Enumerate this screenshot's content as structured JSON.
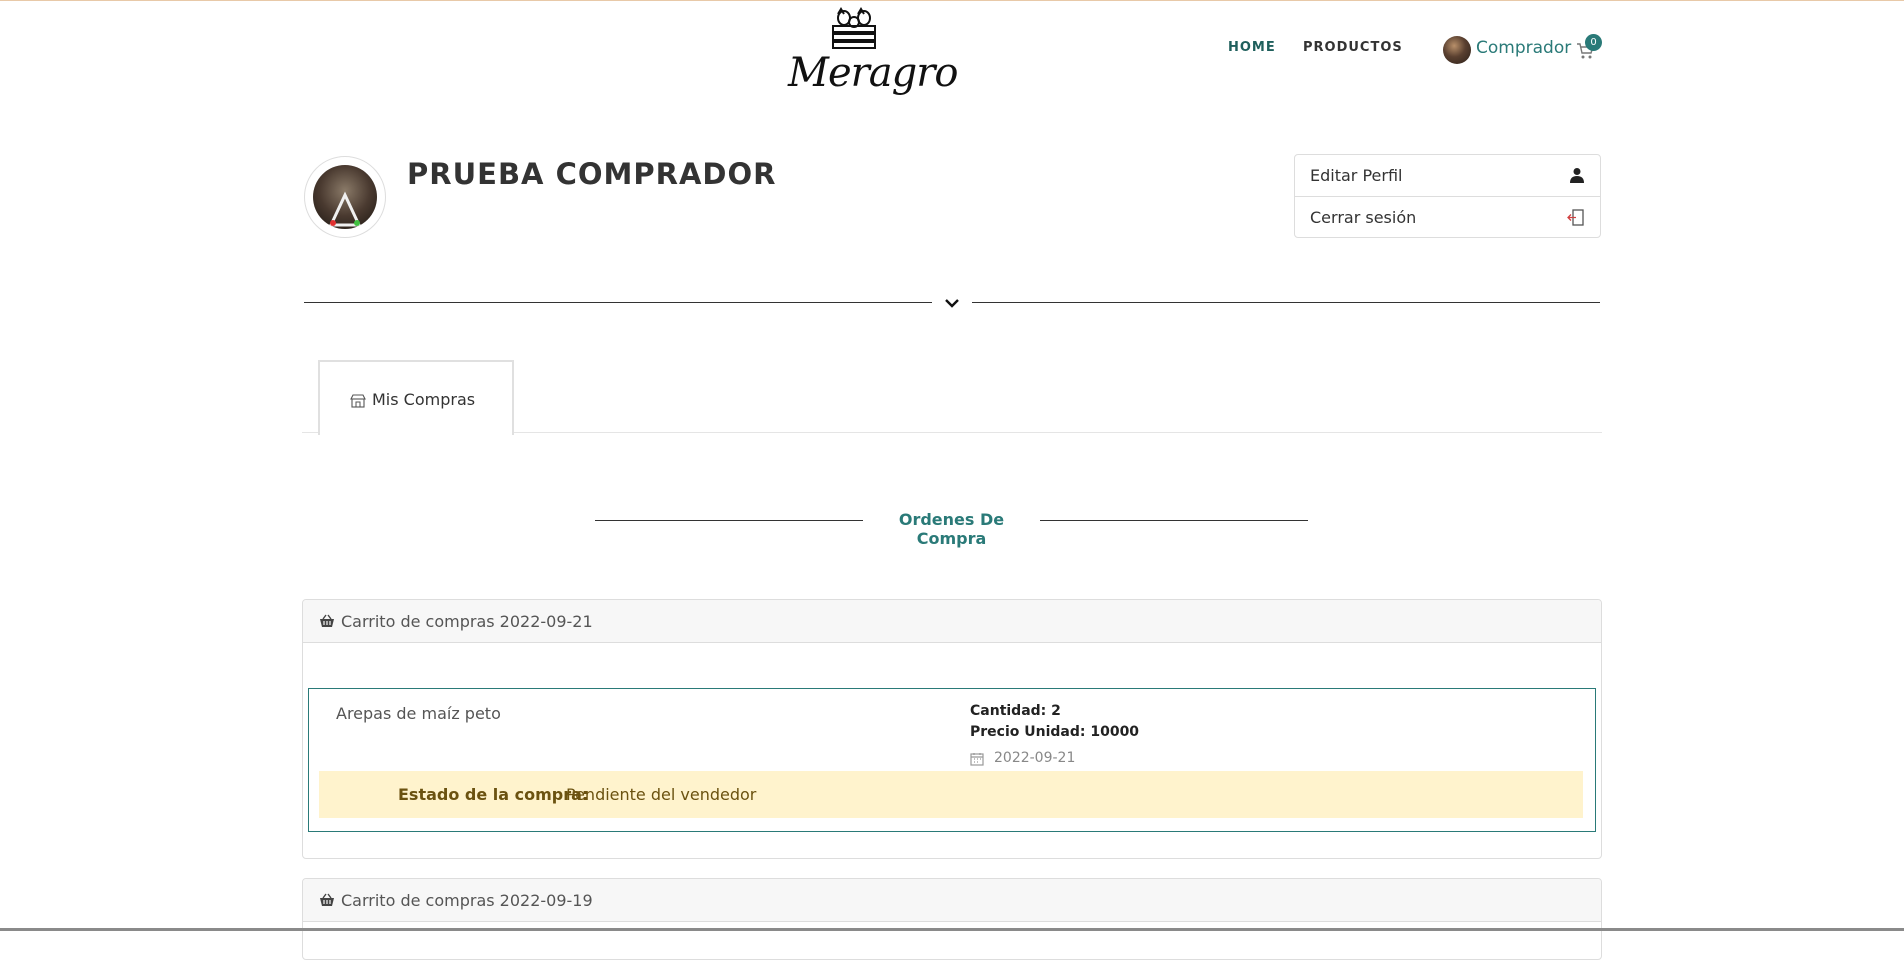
{
  "header": {
    "logo_text": "Meragro",
    "nav": {
      "home": "HOME",
      "products": "PRODUCTOS"
    },
    "user_name": "Comprador",
    "cart_count": "0"
  },
  "profile": {
    "name": "PRUEBA COMPRADOR",
    "menu": {
      "edit": "Editar Perfil",
      "logout": "Cerrar sesión"
    }
  },
  "tabs": [
    {
      "label": "Mis Compras",
      "active": true
    }
  ],
  "section_title": "Ordenes De Compra",
  "orders": [
    {
      "title": "Carrito de compras 2022-09-21",
      "item": {
        "name": "Arepas de maíz peto",
        "quantity_label": "Cantidad: 2",
        "price_label": "Precio Unidad: 10000",
        "date": "2022-09-21",
        "status_key": "Estado de la compra:",
        "status_value": "Pendiente del vendedor"
      }
    },
    {
      "title": "Carrito de compras 2022-09-19"
    }
  ],
  "colors": {
    "accent": "#2a7a78",
    "status_bg": "#fff3cd",
    "status_text": "#6b5210"
  }
}
